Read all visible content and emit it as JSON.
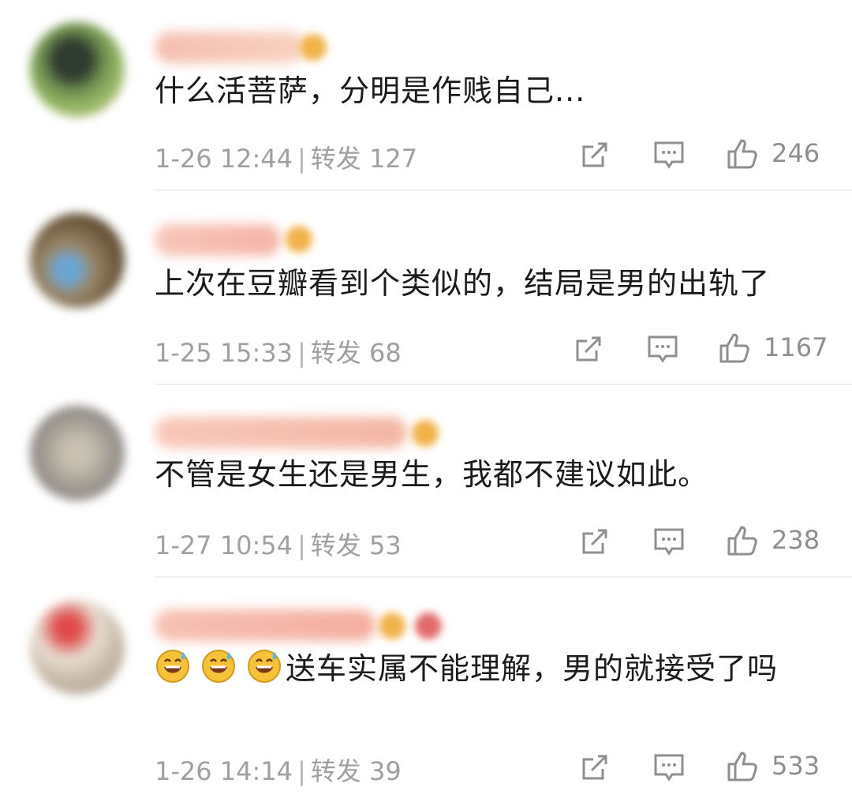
{
  "comments": [
    {
      "text": "什么活菩萨，分明是作贱自己...",
      "time": "1-26 12:44",
      "repost_label": "转发",
      "repost_count": "127",
      "like_count": "246"
    },
    {
      "text": "上次在豆瓣看到个类似的，结局是男的出轨了",
      "time": "1-25 15:33",
      "repost_label": "转发",
      "repost_count": "68",
      "like_count": "1167"
    },
    {
      "text": "不管是女生还是男生，我都不建议如此。",
      "time": "1-27 10:54",
      "repost_label": "转发",
      "repost_count": "53",
      "like_count": "238"
    },
    {
      "text": "送车实属不能理解，男的就接受了吗",
      "emoji": "sweat-smile-emoji",
      "time": "1-26 14:14",
      "repost_label": "转发",
      "repost_count": "39",
      "like_count": "533"
    }
  ],
  "icons": {
    "repost": "share-icon",
    "comment": "comment-icon",
    "like": "thumbs-up-icon"
  },
  "colors": {
    "text": "#1b1b1b",
    "meta": "#a0a0a0",
    "icon": "#8f8f8f",
    "divider": "#efefef"
  }
}
